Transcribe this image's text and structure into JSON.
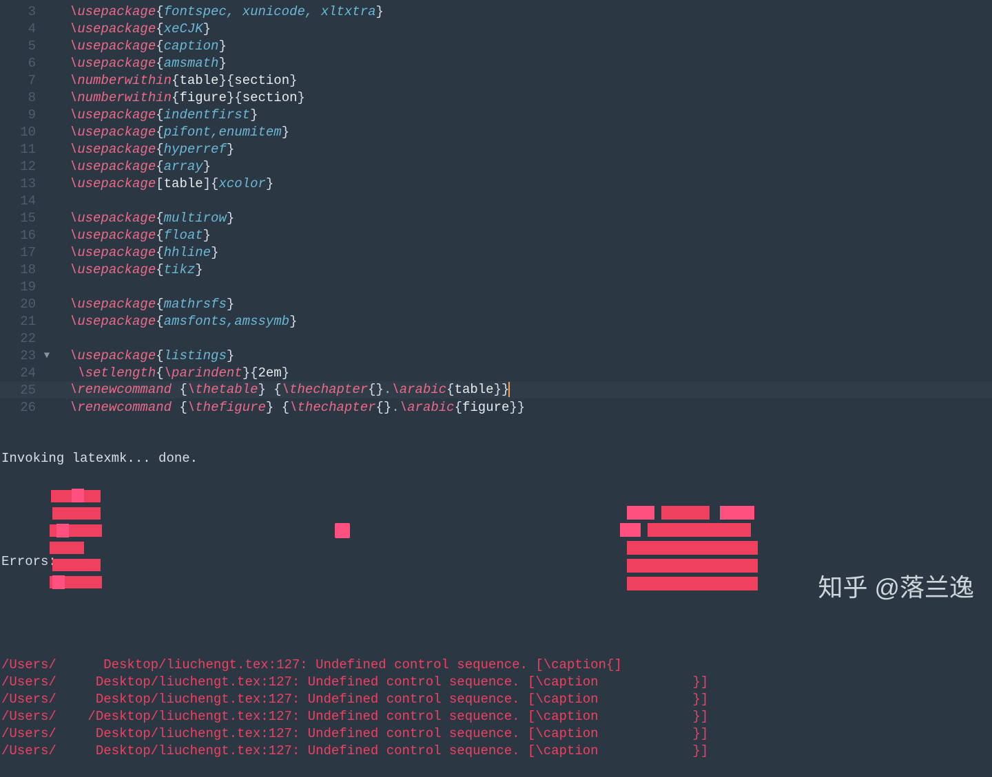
{
  "code_lines": [
    {
      "n": 3,
      "fold": "",
      "tokens": [
        [
          "cmd",
          "\\usepackage"
        ],
        [
          "brace",
          "{"
        ],
        [
          "arg",
          "fontspec"
        ],
        [
          "arg",
          ", "
        ],
        [
          "arg",
          "xunicode"
        ],
        [
          "arg",
          ", "
        ],
        [
          "arg",
          "xltxtra"
        ],
        [
          "brace",
          "}"
        ]
      ]
    },
    {
      "n": 4,
      "fold": "",
      "tokens": [
        [
          "cmd",
          "\\usepackage"
        ],
        [
          "brace",
          "{"
        ],
        [
          "arg",
          "xeCJK"
        ],
        [
          "brace",
          "}"
        ]
      ]
    },
    {
      "n": 5,
      "fold": "",
      "tokens": [
        [
          "cmd",
          "\\usepackage"
        ],
        [
          "brace",
          "{"
        ],
        [
          "arg",
          "caption"
        ],
        [
          "brace",
          "}"
        ]
      ]
    },
    {
      "n": 6,
      "fold": "",
      "tokens": [
        [
          "cmd",
          "\\usepackage"
        ],
        [
          "brace",
          "{"
        ],
        [
          "arg",
          "amsmath"
        ],
        [
          "brace",
          "}"
        ]
      ]
    },
    {
      "n": 7,
      "fold": "",
      "tokens": [
        [
          "cmd",
          "\\numberwithin"
        ],
        [
          "brace",
          "{"
        ],
        [
          "plain",
          "table"
        ],
        [
          "brace",
          "}{"
        ],
        [
          "plain",
          "section"
        ],
        [
          "brace",
          "}"
        ]
      ]
    },
    {
      "n": 8,
      "fold": "",
      "tokens": [
        [
          "cmd",
          "\\numberwithin"
        ],
        [
          "brace",
          "{"
        ],
        [
          "plain",
          "figure"
        ],
        [
          "brace",
          "}{"
        ],
        [
          "plain",
          "section"
        ],
        [
          "brace",
          "}"
        ]
      ]
    },
    {
      "n": 9,
      "fold": "",
      "tokens": [
        [
          "cmd",
          "\\usepackage"
        ],
        [
          "brace",
          "{"
        ],
        [
          "arg",
          "indentfirst"
        ],
        [
          "brace",
          "}"
        ]
      ]
    },
    {
      "n": 10,
      "fold": "",
      "tokens": [
        [
          "cmd",
          "\\usepackage"
        ],
        [
          "brace",
          "{"
        ],
        [
          "arg",
          "pifont"
        ],
        [
          "arg",
          ","
        ],
        [
          "arg",
          "enumitem"
        ],
        [
          "brace",
          "}"
        ]
      ]
    },
    {
      "n": 11,
      "fold": "",
      "tokens": [
        [
          "cmd",
          "\\usepackage"
        ],
        [
          "brace",
          "{"
        ],
        [
          "arg",
          "hyperref"
        ],
        [
          "brace",
          "}"
        ]
      ]
    },
    {
      "n": 12,
      "fold": "",
      "tokens": [
        [
          "cmd",
          "\\usepackage"
        ],
        [
          "brace",
          "{"
        ],
        [
          "arg",
          "array"
        ],
        [
          "brace",
          "}"
        ]
      ]
    },
    {
      "n": 13,
      "fold": "",
      "tokens": [
        [
          "cmd",
          "\\usepackage"
        ],
        [
          "brace",
          "["
        ],
        [
          "plain",
          "table"
        ],
        [
          "brace",
          "]{"
        ],
        [
          "arg",
          "xcolor"
        ],
        [
          "brace",
          "}"
        ]
      ]
    },
    {
      "n": 14,
      "fold": "",
      "tokens": []
    },
    {
      "n": 15,
      "fold": "",
      "tokens": [
        [
          "cmd",
          "\\usepackage"
        ],
        [
          "brace",
          "{"
        ],
        [
          "arg",
          "multirow"
        ],
        [
          "brace",
          "}"
        ]
      ]
    },
    {
      "n": 16,
      "fold": "",
      "tokens": [
        [
          "cmd",
          "\\usepackage"
        ],
        [
          "brace",
          "{"
        ],
        [
          "arg",
          "float"
        ],
        [
          "brace",
          "}"
        ]
      ]
    },
    {
      "n": 17,
      "fold": "",
      "tokens": [
        [
          "cmd",
          "\\usepackage"
        ],
        [
          "brace",
          "{"
        ],
        [
          "arg",
          "hhline"
        ],
        [
          "brace",
          "}"
        ]
      ]
    },
    {
      "n": 18,
      "fold": "",
      "tokens": [
        [
          "cmd",
          "\\usepackage"
        ],
        [
          "brace",
          "{"
        ],
        [
          "arg",
          "tikz"
        ],
        [
          "brace",
          "}"
        ]
      ]
    },
    {
      "n": 19,
      "fold": "",
      "tokens": []
    },
    {
      "n": 20,
      "fold": "",
      "tokens": [
        [
          "cmd",
          "\\usepackage"
        ],
        [
          "brace",
          "{"
        ],
        [
          "arg",
          "mathrsfs"
        ],
        [
          "brace",
          "}"
        ]
      ]
    },
    {
      "n": 21,
      "fold": "",
      "tokens": [
        [
          "cmd",
          "\\usepackage"
        ],
        [
          "brace",
          "{"
        ],
        [
          "arg",
          "amsfonts"
        ],
        [
          "arg",
          ","
        ],
        [
          "arg",
          "amssymb"
        ],
        [
          "brace",
          "}"
        ]
      ]
    },
    {
      "n": 22,
      "fold": "",
      "tokens": []
    },
    {
      "n": 23,
      "fold": "▼",
      "tokens": [
        [
          "cmd",
          "\\usepackage"
        ],
        [
          "brace",
          "{"
        ],
        [
          "arg",
          "listings"
        ],
        [
          "brace",
          "}"
        ]
      ]
    },
    {
      "n": 24,
      "fold": "",
      "indent": 1,
      "tokens": [
        [
          "cmd",
          "\\setlength"
        ],
        [
          "brace",
          "{"
        ],
        [
          "cmd",
          "\\parindent"
        ],
        [
          "brace",
          "}{"
        ],
        [
          "plain",
          "2em"
        ],
        [
          "brace",
          "}"
        ]
      ]
    },
    {
      "n": 25,
      "fold": "",
      "current": true,
      "tokens": [
        [
          "cmd",
          "\\renewcommand "
        ],
        [
          "brace",
          "{"
        ],
        [
          "cmd",
          "\\thetable"
        ],
        [
          "brace",
          "} "
        ],
        [
          "brace",
          "{"
        ],
        [
          "cmd",
          "\\thechapter"
        ],
        [
          "brace",
          "{}"
        ],
        [
          "dot",
          "."
        ],
        [
          "cmd",
          "\\arabic"
        ],
        [
          "brace",
          "{"
        ],
        [
          "plain",
          "table"
        ],
        [
          "brace",
          "}}"
        ],
        [
          "cursor",
          ""
        ]
      ]
    },
    {
      "n": 26,
      "fold": "",
      "tokens": [
        [
          "cmd",
          "\\renewcommand "
        ],
        [
          "brace",
          "{"
        ],
        [
          "cmd",
          "\\thefigure"
        ],
        [
          "brace",
          "} "
        ],
        [
          "brace",
          "{"
        ],
        [
          "cmd",
          "\\thechapter"
        ],
        [
          "brace",
          "{}"
        ],
        [
          "dot",
          "."
        ],
        [
          "cmd",
          "\\arabic"
        ],
        [
          "brace",
          "{"
        ],
        [
          "plain",
          "figure"
        ],
        [
          "brace",
          "}}"
        ]
      ]
    }
  ],
  "output": {
    "invoke": "Invoking latexmk... done.",
    "errors_header": "Errors:",
    "errors": [
      "/Users/      Desktop/liuchengt.tex:127: Undefined control sequence. [\\caption{]",
      "/Users/     Desktop/liuchengt.tex:127: Undefined control sequence. [\\caption            }]",
      "/Users/     Desktop/liuchengt.tex:127: Undefined control sequence. [\\caption            }]",
      "/Users/    /Desktop/liuchengt.tex:127: Undefined control sequence. [\\caption            }]",
      "/Users/     Desktop/liuchengt.tex:127: Undefined control sequence. [\\caption            }]",
      "/Users/     Desktop/liuchengt.tex:127: Undefined control sequence. [\\caption            }]"
    ]
  },
  "watermark": "知乎 @落兰逸"
}
